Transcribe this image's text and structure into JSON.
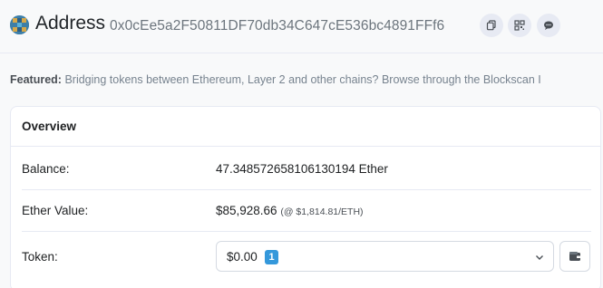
{
  "header": {
    "title": "Address",
    "address": "0x0cEe5a2F50811DF70db34C647cE536bc4891FFf6",
    "buttons": [
      {
        "icon": "copy-icon"
      },
      {
        "icon": "qr-code-icon"
      },
      {
        "icon": "comment-icon"
      }
    ]
  },
  "featured": {
    "label": "Featured:",
    "text": "Bridging tokens between Ethereum, Layer 2 and other chains? Browse through the Blockscan I"
  },
  "overview": {
    "title": "Overview",
    "balance": {
      "label": "Balance:",
      "value": "47.348572658106130194 Ether"
    },
    "ether_value": {
      "label": "Ether Value:",
      "value": "$85,928.66",
      "rate": "(@ $1,814.81/ETH)"
    },
    "token": {
      "label": "Token:",
      "value": "$0.00",
      "count": "1"
    }
  },
  "colors": {
    "badge": "#3498db",
    "muted": "#77838f",
    "border": "#e7eaf3"
  }
}
